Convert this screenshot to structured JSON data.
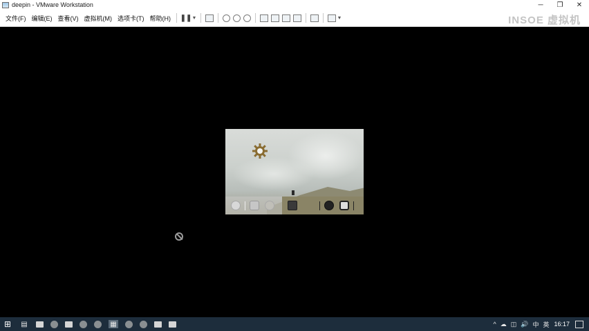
{
  "window": {
    "title": "deepin - VMware Workstation",
    "controls": [
      "─",
      "❐",
      "✕"
    ]
  },
  "menu": {
    "items": [
      "文件(F)",
      "编辑(E)",
      "查看(V)",
      "虚拟机(M)",
      "选项卡(T)",
      "帮助(H)"
    ]
  },
  "watermark": "INSOE 虚拟机",
  "taskbar": {
    "tray": {
      "up_arrow": "^",
      "volume": "🔊",
      "battery": "◫",
      "network": "☁",
      "input": "中",
      "ime_state": "英",
      "time": "16:17"
    }
  },
  "colors": {
    "background": "#000000",
    "taskbar": "#1d2d3c",
    "dock_dark": "#8a8466"
  }
}
